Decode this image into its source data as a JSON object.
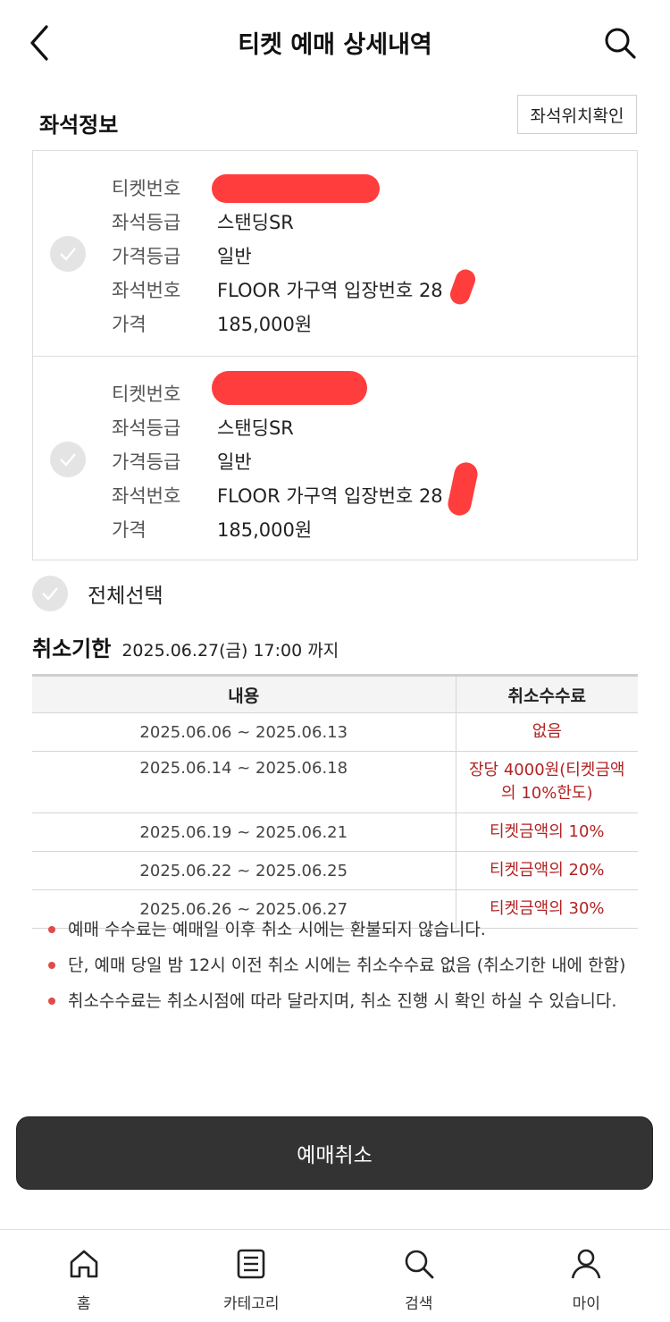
{
  "header": {
    "title": "티켓 예매 상세내역"
  },
  "seat_section": {
    "title": "좌석정보",
    "location_button": "좌석위치확인",
    "tickets": [
      {
        "rows": [
          {
            "label": "티켓번호",
            "value": ""
          },
          {
            "label": "좌석등급",
            "value": "스탠딩SR"
          },
          {
            "label": "가격등급",
            "value": "일반"
          },
          {
            "label": "좌석번호",
            "value": "FLOOR 가구역 입장번호 28"
          },
          {
            "label": "가격",
            "value": "185,000원"
          }
        ]
      },
      {
        "rows": [
          {
            "label": "티켓번호",
            "value": ""
          },
          {
            "label": "좌석등급",
            "value": "스탠딩SR"
          },
          {
            "label": "가격등급",
            "value": "일반"
          },
          {
            "label": "좌석번호",
            "value": "FLOOR 가구역 입장번호 28"
          },
          {
            "label": "가격",
            "value": "185,000원"
          }
        ]
      }
    ],
    "select_all": "전체선택"
  },
  "cancel_deadline": {
    "title": "취소기한",
    "date": "2025.06.27(금) 17:00 까지"
  },
  "fee_table": {
    "headers": [
      "내용",
      "취소수수료"
    ],
    "rows": [
      {
        "period": "2025.06.06 ~ 2025.06.13",
        "fee": "없음"
      },
      {
        "period": "2025.06.14 ~ 2025.06.18",
        "fee": "장당 4000원(티켓금액의 10%한도)"
      },
      {
        "period": "2025.06.19 ~ 2025.06.21",
        "fee": "티켓금액의 10%"
      },
      {
        "period": "2025.06.22 ~ 2025.06.25",
        "fee": "티켓금액의 20%"
      },
      {
        "period": "2025.06.26 ~ 2025.06.27",
        "fee": "티켓금액의 30%"
      }
    ]
  },
  "notes": [
    "예매 수수료는 예매일 이후 취소 시에는 환불되지 않습니다.",
    "단, 예매 당일 밤 12시 이전 취소 시에는 취소수수료 없음 (취소기한 내에 한함)",
    "취소수수료는 취소시점에 따라 달라지며, 취소 진행 시 확인 하실 수 있습니다."
  ],
  "cancel_button": "예매취소",
  "tabbar": {
    "items": [
      {
        "label": "홈",
        "icon": "home-icon"
      },
      {
        "label": "카테고리",
        "icon": "list-icon"
      },
      {
        "label": "검색",
        "icon": "search-icon"
      },
      {
        "label": "마이",
        "icon": "person-icon"
      }
    ]
  },
  "colors": {
    "accent_red": "#b22222",
    "bullet_red": "#e04a4a",
    "button_dark": "#333333",
    "redaction": "#ff3d3d"
  }
}
